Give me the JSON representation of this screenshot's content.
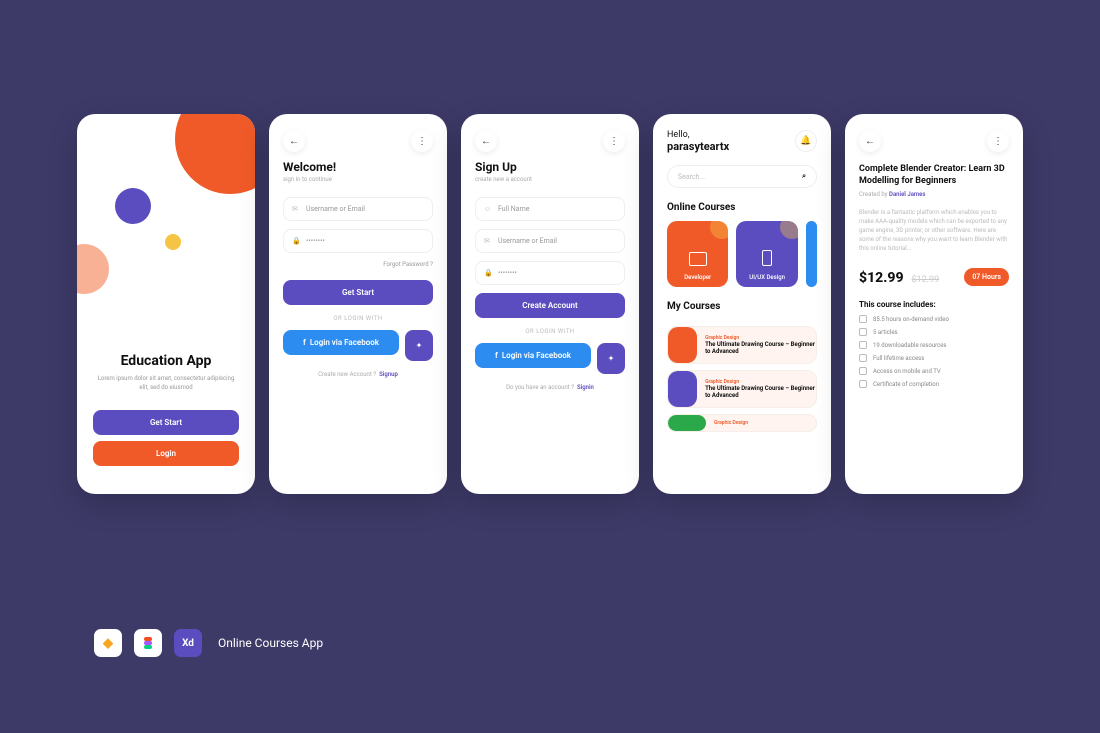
{
  "onboard": {
    "title": "Education App",
    "subtitle": "Lorem ipsum dolor sit amet, consectetur adipiscing elit, sed do eiusmod",
    "get_start": "Get Start",
    "login": "Login"
  },
  "signin": {
    "title": "Welcome!",
    "subtitle": "sign in to continue",
    "user_ph": "Username or Email",
    "pass_ph": "••••••••",
    "forgot": "Forgot Password ?",
    "get_start": "Get Start",
    "divider": "OR LOGIN WITH",
    "fb": "Login via Facebook",
    "bottom_q": "Create new Account ?",
    "bottom_link": "Signup"
  },
  "signup": {
    "title": "Sign Up",
    "subtitle": "create new a account",
    "name_ph": "Full Name",
    "user_ph": "Username or Email",
    "pass_ph": "••••••••",
    "create": "Create Account",
    "divider": "OR LOGIN WITH",
    "fb": "Login via Facebook",
    "bottom_q": "Do you have an account ?",
    "bottom_link": "Signin"
  },
  "home": {
    "hello": "Hello,",
    "username": "parasyteartx",
    "search_ph": "Search...",
    "section_online": "Online Courses",
    "cat_dev": "Developer",
    "cat_ui": "UI/UX Design",
    "section_my": "My Courses",
    "course_tag": "Graphic Design",
    "course_title": "The Ultimate Drawing Course – Beginner to Advanced"
  },
  "detail": {
    "title": "Complete Blender Creator: Learn 3D Modelling for Beginners",
    "author_label": "Created by",
    "author": "Daniel James",
    "desc": "Blender is a fantastic platform which enables you to make AAA-quality models which can be exported to any game engine, 3D printer, or other software. Here are some of the reasons why you want to learn Blender with this online tutorial...",
    "price": "$12.99",
    "price_old": "$12.99",
    "duration": "07 Hours",
    "includes_title": "This course includes:",
    "includes": [
      "85.5 hours on-demand video",
      "5 articles",
      "19 downloadable resources",
      "Full lifetime access",
      "Access on mobile and TV",
      "Certificate of completion"
    ]
  },
  "footer": {
    "label": "Online Courses App",
    "xd": "Xd"
  }
}
